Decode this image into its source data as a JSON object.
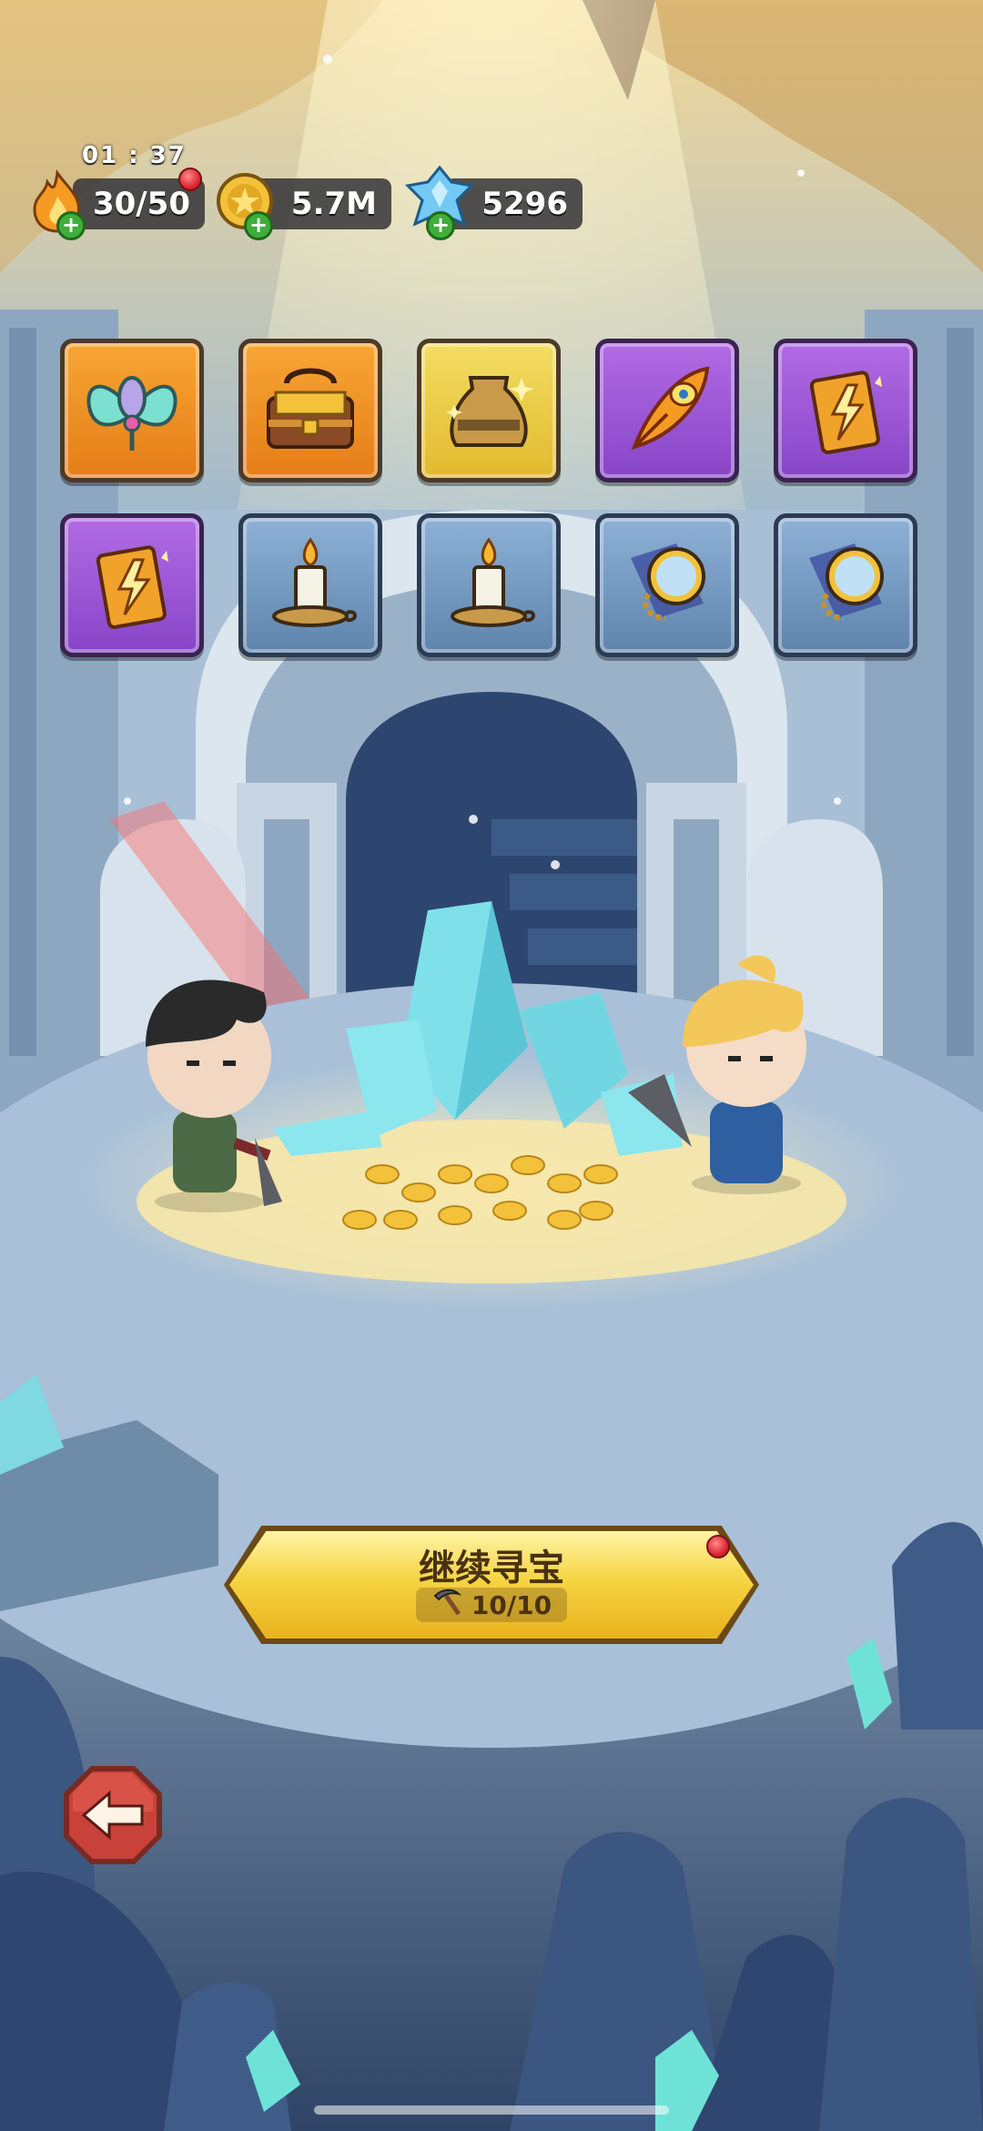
{
  "hud": {
    "timer": "01 : 37",
    "energy": "30/50",
    "gold": "5.7M",
    "crystals": "5296"
  },
  "rewards": [
    {
      "name": "butterfly-bow",
      "rarity": "orange"
    },
    {
      "name": "treasure-chest",
      "rarity": "orange"
    },
    {
      "name": "loot-sack",
      "rarity": "gold"
    },
    {
      "name": "phoenix-feather",
      "rarity": "purple"
    },
    {
      "name": "lightning-scroll",
      "rarity": "purple"
    },
    {
      "name": "lightning-scroll",
      "rarity": "purple"
    },
    {
      "name": "candle",
      "rarity": "blue"
    },
    {
      "name": "candle",
      "rarity": "blue"
    },
    {
      "name": "pocket-watch",
      "rarity": "blue"
    },
    {
      "name": "pocket-watch",
      "rarity": "blue"
    }
  ],
  "continue_button": {
    "label": "继续寻宝",
    "counter": "10/10"
  },
  "colors": {
    "cta_gold": "#f6d443",
    "pill_bg": "#2d2d32",
    "back_red": "#c8423a"
  }
}
